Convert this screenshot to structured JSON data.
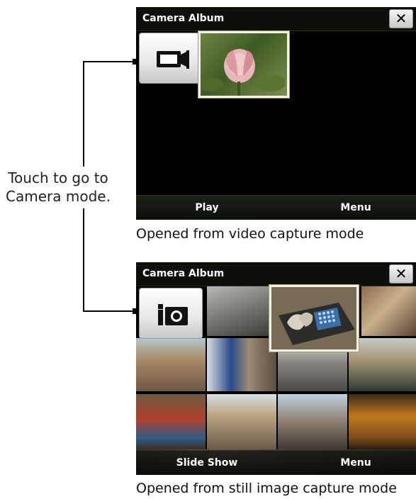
{
  "callout": {
    "text": "Touch to go to\nCamera mode."
  },
  "video_album": {
    "title": "Camera Album",
    "close_glyph": "✕",
    "mode_button_icon": "video-camera-icon",
    "left_softkey": "Play",
    "right_softkey": "Menu",
    "caption": "Opened from video capture mode"
  },
  "still_album": {
    "title": "Camera Album",
    "close_glyph": "✕",
    "mode_button_icon": "camera-icon",
    "left_softkey": "Slide Show",
    "right_softkey": "Menu",
    "caption": "Opened from still image capture mode"
  },
  "colors": {
    "window_bg": "#000000",
    "titlebar_bg": "#0c0f0a",
    "selection_border": "#f3f1e2",
    "softkey_text": "#ffffff"
  }
}
